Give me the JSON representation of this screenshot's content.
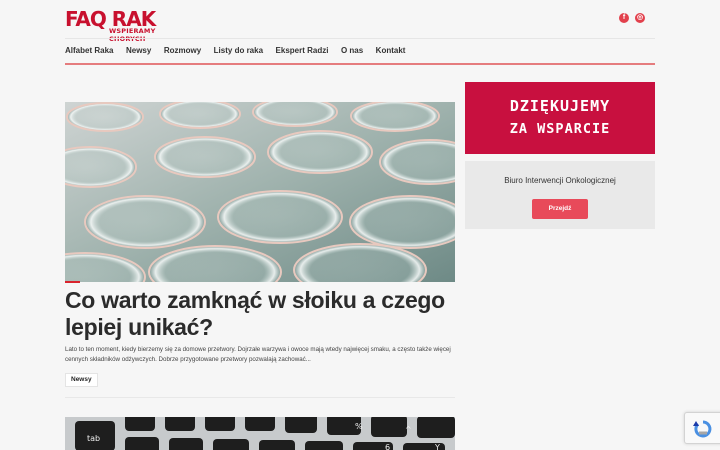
{
  "logo": {
    "main": "FAQ RAK",
    "tagline": "WSPIERAMY CHORYCH"
  },
  "socials": [
    {
      "icon": "facebook-icon",
      "glyph": "f"
    },
    {
      "icon": "instagram-icon",
      "glyph": "◎"
    }
  ],
  "nav": [
    "Alfabet Raka",
    "Newsy",
    "Rozmowy",
    "Listy do raka",
    "Ekspert Radzi",
    "O nas",
    "Kontakt"
  ],
  "post": {
    "title": "Co warto zamknąć w słoiku a czego lepiej unikać?",
    "excerpt": "Lato to ten moment, kiedy bierzemy się za domowe przetwory. Dojrzałe warzywa i owoce mają wtedy najwięcej smaku, a często także więcej cennych składników odżywczych. Dobrze przygotowane przetwory pozwalają zachować...",
    "tag": "Newsy"
  },
  "sidebar": {
    "banner_line1": "DZIĘKUJEMY",
    "banner_line2": "ZA WSPARCIE",
    "widget_title": "Biuro Interwencji Onkologicznej",
    "widget_button": "Przejdź"
  },
  "colors": {
    "brand": "#c8102e",
    "banner": "#c8103f",
    "button": "#e84a5a",
    "nav_line": "#e57c7e"
  }
}
